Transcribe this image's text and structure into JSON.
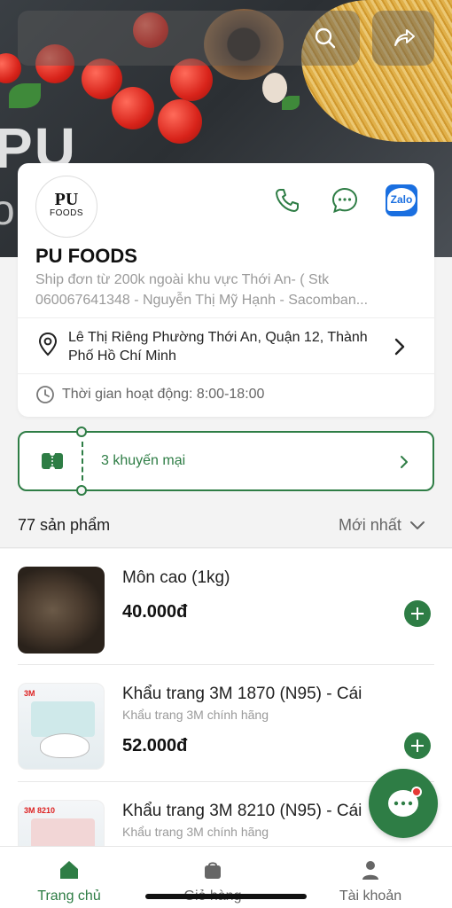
{
  "store": {
    "logo_line1": "PU",
    "logo_line2": "FOODS",
    "name": "PU FOODS",
    "description": "Ship đơn từ 200k ngoài khu vực Thới An- ( Stk 060067641348 - Nguyễn Thị Mỹ Hạnh - Sacomban...",
    "address": "Lê Thị Riêng Phường Thới An, Quận 12, Thành Phố Hồ Chí Minh",
    "hours": "Thời gian hoạt động: 8:00-18:00",
    "zalo_label": "Zalo"
  },
  "hero": {
    "overlay_text_1": "PU",
    "overlay_text_2": "o"
  },
  "promo": {
    "label": "3 khuyến mại"
  },
  "products_header": {
    "count_label": "77 sản phẩm",
    "sort_label": "Mới nhất"
  },
  "products": [
    {
      "name": "Môn cao (1kg)",
      "subtitle": "",
      "price": "40.000đ"
    },
    {
      "name": "Khẩu trang 3M 1870 (N95) - Cái",
      "subtitle": "Khẩu trang 3M chính hãng",
      "price": "52.000đ"
    },
    {
      "name": "Khẩu trang 3M 8210 (N95) - Cái",
      "subtitle": "Khẩu trang 3M chính hãng",
      "price": ""
    }
  ],
  "thumb_labels": {
    "mask1": "3M",
    "mask2": "3M 8210"
  },
  "bottom_nav": [
    {
      "label": "Trang chủ",
      "icon": "home-icon",
      "active": true
    },
    {
      "label": "Giỏ hàng",
      "icon": "bag-icon",
      "active": false
    },
    {
      "label": "Tài khoản",
      "icon": "user-icon",
      "active": false
    }
  ],
  "colors": {
    "accent": "#2e7d45",
    "badge": "#e53935",
    "zalo": "#1a6fe0"
  }
}
